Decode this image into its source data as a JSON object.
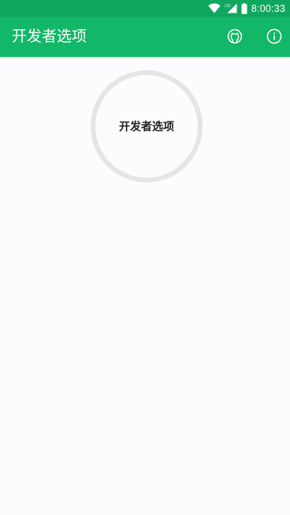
{
  "status_bar": {
    "time": "8:00:33",
    "network": "LTE",
    "icons": [
      "wifi-icon",
      "lte-signal-icon",
      "battery-icon"
    ]
  },
  "app_bar": {
    "title": "开发者选项",
    "actions": [
      "github-icon",
      "info-icon"
    ],
    "color": "#12b767"
  },
  "main": {
    "center_button_label": "开发者选项"
  },
  "colors": {
    "status_bar": "#0fa75e",
    "app_bar": "#12b767",
    "background": "#fdfbfd",
    "ring": "#e5e5e5"
  }
}
